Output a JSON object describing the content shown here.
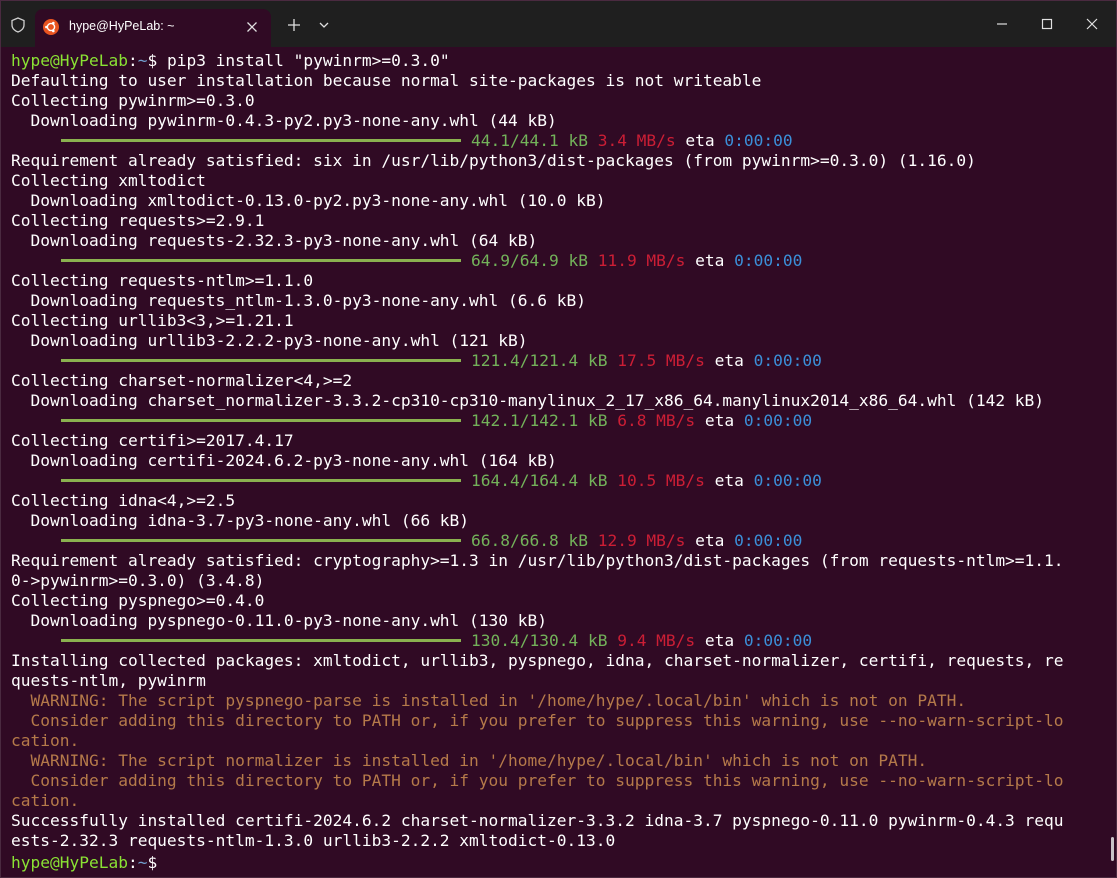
{
  "window": {
    "tab_title": "hype@HyPeLab: ~",
    "icons": {
      "shield": "shield-icon",
      "tab_icon": "ubuntu-icon",
      "tab_close": "close-icon",
      "new_tab": "plus-icon",
      "dropdown": "chevron-down-icon",
      "minimize": "minimize-icon",
      "maximize": "maximize-icon",
      "close": "close-icon"
    }
  },
  "colors": {
    "background": "#300a24",
    "prompt_user": "#8ae234",
    "prompt_path": "#729fcf",
    "progress_bar": "#8ab14f",
    "size_text": "#73b25a",
    "speed_text": "#cc1e35",
    "eta_value": "#3b8fd8",
    "warning_text": "#b57a4a"
  },
  "terminal": {
    "prompt_user": "hype@HyPeLab",
    "prompt_sep": ":",
    "prompt_path": "~",
    "prompt_symbol": "$ ",
    "command": "pip3 install \"pywinrm>=0.3.0\"",
    "lines": {
      "l1": "Defaulting to user installation because normal site-packages is not writeable",
      "l2": "Collecting pywinrm>=0.3.0",
      "l3": "  Downloading pywinrm-0.4.3-py2.py3-none-any.whl (44 kB)",
      "l5": "Requirement already satisfied: six in /usr/lib/python3/dist-packages (from pywinrm>=0.3.0) (1.16.0)",
      "l6": "Collecting xmltodict",
      "l7": "  Downloading xmltodict-0.13.0-py2.py3-none-any.whl (10.0 kB)",
      "l8": "Collecting requests>=2.9.1",
      "l9": "  Downloading requests-2.32.3-py3-none-any.whl (64 kB)",
      "l11": "Collecting requests-ntlm>=1.1.0",
      "l12": "  Downloading requests_ntlm-1.3.0-py3-none-any.whl (6.6 kB)",
      "l13": "Collecting urllib3<3,>=1.21.1",
      "l14": "  Downloading urllib3-2.2.2-py3-none-any.whl (121 kB)",
      "l16": "Collecting charset-normalizer<4,>=2",
      "l17": "  Downloading charset_normalizer-3.3.2-cp310-cp310-manylinux_2_17_x86_64.manylinux2014_x86_64.whl (142 kB)",
      "l19": "Collecting certifi>=2017.4.17",
      "l20": "  Downloading certifi-2024.6.2-py3-none-any.whl (164 kB)",
      "l22": "Collecting idna<4,>=2.5",
      "l23": "  Downloading idna-3.7-py3-none-any.whl (66 kB)",
      "l25": "Requirement already satisfied: cryptography>=1.3 in /usr/lib/python3/dist-packages (from requests-ntlm>=1.1.",
      "l26": "0->pywinrm>=0.3.0) (3.4.8)",
      "l27": "Collecting pyspnego>=0.4.0",
      "l28": "  Downloading pyspnego-0.11.0-py3-none-any.whl (130 kB)",
      "l30": "Installing collected packages: xmltodict, urllib3, pyspnego, idna, charset-normalizer, certifi, requests, re",
      "l31": "quests-ntlm, pywinrm",
      "l32": "  WARNING: The script pyspnego-parse is installed in '/home/hype/.local/bin' which is not on PATH.",
      "l33": "  Consider adding this directory to PATH or, if you prefer to suppress this warning, use --no-warn-script-lo",
      "l34": "cation.",
      "l35": "  WARNING: The script normalizer is installed in '/home/hype/.local/bin' which is not on PATH.",
      "l36": "  Consider adding this directory to PATH or, if you prefer to suppress this warning, use --no-warn-script-lo",
      "l37": "cation.",
      "l38": "Successfully installed certifi-2024.6.2 charset-normalizer-3.3.2 idna-3.7 pyspnego-0.11.0 pywinrm-0.4.3 requ",
      "l39": "ests-2.32.3 requests-ntlm-1.3.0 urllib3-2.2.2 xmltodict-0.13.0"
    },
    "progress": [
      {
        "size": "44.1/44.1 kB",
        "speed": "3.4 MB/s",
        "eta_label": "eta",
        "eta": "0:00:00",
        "fraction": 1.0
      },
      {
        "size": "64.9/64.9 kB",
        "speed": "11.9 MB/s",
        "eta_label": "eta",
        "eta": "0:00:00",
        "fraction": 1.0
      },
      {
        "size": "121.4/121.4 kB",
        "speed": "17.5 MB/s",
        "eta_label": "eta",
        "eta": "0:00:00",
        "fraction": 1.0
      },
      {
        "size": "142.1/142.1 kB",
        "speed": "6.8 MB/s",
        "eta_label": "eta",
        "eta": "0:00:00",
        "fraction": 1.0
      },
      {
        "size": "164.4/164.4 kB",
        "speed": "10.5 MB/s",
        "eta_label": "eta",
        "eta": "0:00:00",
        "fraction": 1.0
      },
      {
        "size": "66.8/66.8 kB",
        "speed": "12.9 MB/s",
        "eta_label": "eta",
        "eta": "0:00:00",
        "fraction": 1.0
      },
      {
        "size": "130.4/130.4 kB",
        "speed": "9.4 MB/s",
        "eta_label": "eta",
        "eta": "0:00:00",
        "fraction": 1.0
      }
    ]
  }
}
